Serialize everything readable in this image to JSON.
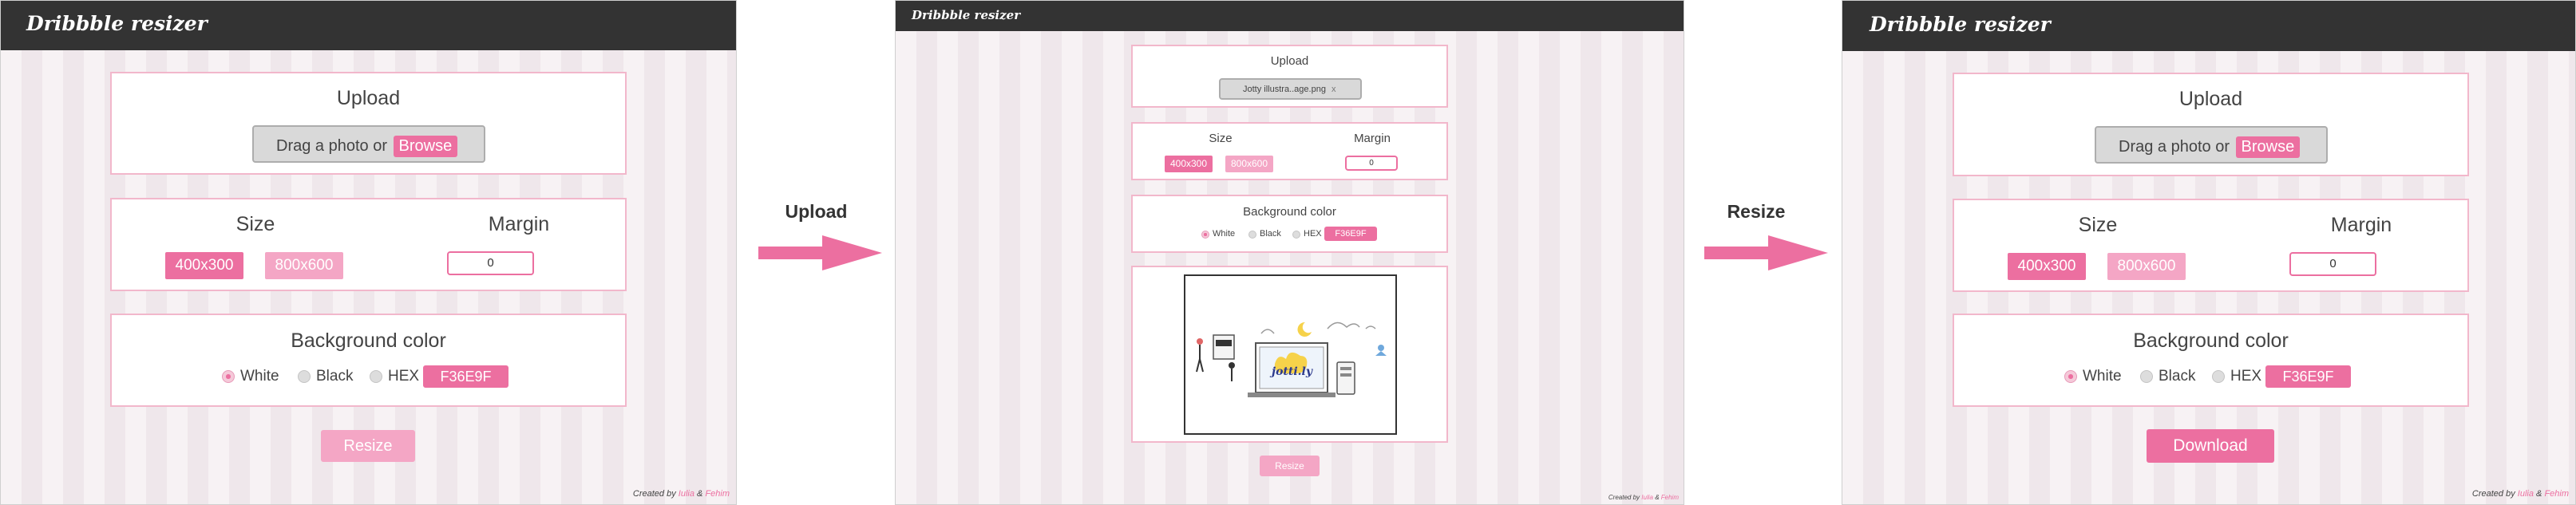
{
  "accent_color": "#EC6FA0",
  "app": {
    "logo": "Dribbble resizer"
  },
  "upload_section": {
    "title": "Upload",
    "drag_text": "Drag a photo or",
    "browse_label": "Browse",
    "uploaded_file": "Jotty illustra..age.png",
    "remove_icon": "x"
  },
  "size_section": {
    "title": "Size",
    "options": [
      "400x300",
      "800x600"
    ],
    "selected_option": "400x300"
  },
  "margin_section": {
    "title": "Margin",
    "value": "0"
  },
  "background_section": {
    "title": "Background color",
    "options": [
      "White",
      "Black",
      "HEX"
    ],
    "selected_option": "White",
    "hex_value": "F36E9F"
  },
  "actions": {
    "resize_label": "Resize",
    "download_label": "Download"
  },
  "footer": {
    "prefix": "Created by",
    "author1": "Iulia",
    "separator": "&",
    "author2": "Fehim"
  },
  "flow": {
    "step1_label": "Upload",
    "step2_label": "Resize"
  }
}
